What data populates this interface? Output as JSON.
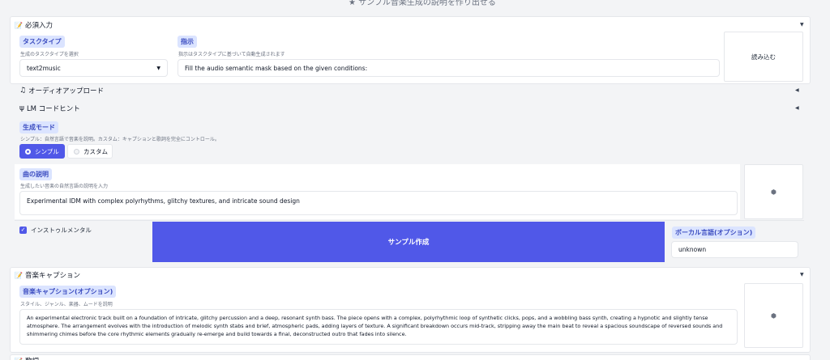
{
  "header": {
    "title": "★ サンプル音楽生成の説明を作り出せる"
  },
  "required": {
    "title": "必須入力",
    "task_type": {
      "label": "タスクタイプ",
      "hint": "生成のタスクタイプを選択",
      "value": "text2music"
    },
    "instruction": {
      "label": "指示",
      "hint": "指示はタスクタイプに基づいて自動生成されます",
      "value": "Fill the audio semantic mask based on the given conditions:"
    },
    "load_button": "読み込む"
  },
  "audio_upload": {
    "title": "オーディオアップロード"
  },
  "lm_hints": {
    "title": "LM コードヒント"
  },
  "mode": {
    "label": "生成モード",
    "hint": "シンプル：自然言語で音楽を説明。カスタム：キャプションと歌詞を完全にコントロール。",
    "options": [
      "シンプル",
      "カスタム"
    ],
    "selected": "シンプル"
  },
  "song_desc": {
    "label": "曲の説明",
    "hint": "生成したい音楽の自然言語の説明を入力",
    "value": "Experimental IDM with complex polyrhythms, glitchy textures, and intricate sound design"
  },
  "instrumental": {
    "label": "インストゥルメンタル",
    "checked": true
  },
  "create_sample_button": "サンプル作成",
  "vocal_language": {
    "label": "ボーカル言語(オプション)",
    "value": "unknown"
  },
  "caption_section": {
    "title": "音楽キャプション",
    "label": "音楽キャプション(オプション)",
    "hint": "スタイル、ジャンル、楽器、ムードを説明",
    "value": "An experimental electronic track built on a foundation of intricate, glitchy percussion and a deep, resonant synth bass. The piece opens with a complex, polyrhythmic loop of synthetic clicks, pops, and a wobbling bass synth, creating a hypnotic and slightly tense atmosphere. The arrangement evolves with the introduction of melodic synth stabs and brief, atmospheric pads, adding layers of texture. A significant breakdown occurs mid-track, stripping away the main beat to reveal a spacious soundscape of reversed sounds and shimmering chimes before the core rhythmic elements gradually re-emerge and build towards a final, deconstructed outro that fades into silence."
  },
  "lyrics_section": {
    "title": "歌詞"
  },
  "colors": {
    "accent": "#5058e8",
    "tag_bg": "#dbe4ff",
    "tag_text": "#3b4cc0"
  },
  "icons": {
    "dice": "dice-icon",
    "note": "note-icon",
    "memo": "memo-icon",
    "pitchfork": "tuning-icon"
  }
}
